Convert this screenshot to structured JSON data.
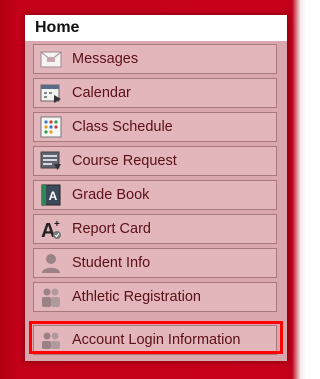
{
  "home_label": "Home",
  "colors": {
    "frame_red": "#c9001c",
    "panel_pink": "#d9a7ad",
    "item_bg": "#e2b6bb",
    "item_text": "#5a1016",
    "highlight": "#ff0000"
  },
  "menu": [
    {
      "label": "Messages",
      "icon": "envelope-icon"
    },
    {
      "label": "Calendar",
      "icon": "calendar-icon"
    },
    {
      "label": "Class Schedule",
      "icon": "schedule-grid-icon"
    },
    {
      "label": "Course Request",
      "icon": "course-request-icon"
    },
    {
      "label": "Grade Book",
      "icon": "grade-book-icon"
    },
    {
      "label": "Report Card",
      "icon": "report-card-icon"
    },
    {
      "label": "Student Info",
      "icon": "student-icon"
    },
    {
      "label": "Athletic Registration",
      "icon": "group-icon"
    },
    {
      "label": "Account Login Information",
      "icon": "account-group-icon",
      "highlighted": true
    }
  ]
}
